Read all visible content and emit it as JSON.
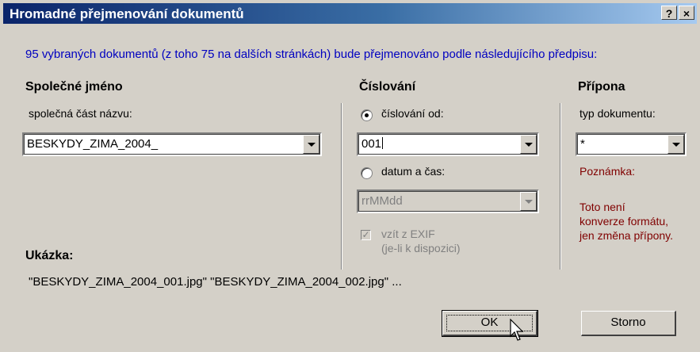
{
  "window": {
    "title": "Hromadné přejmenování dokumentů",
    "help_label": "?",
    "close_label": "×"
  },
  "info_text": "95 vybraných dokumentů (z toho 75 na dalších stránkách) bude přejmenováno podle následujícího předpisu:",
  "common_name": {
    "title": "Společné jméno",
    "field_label": "společná část názvu:",
    "value": "BESKYDY_ZIMA_2004_"
  },
  "numbering": {
    "title": "Číslování",
    "option_number_label": "číslování od:",
    "option_number_selected": true,
    "number_value": "001",
    "option_datetime_label": "datum a čas:",
    "datetime_format": "rrMMdd",
    "exif_label_line1": "vzít z EXIF",
    "exif_label_line2": "(je-li k dispozici)",
    "exif_checked": true
  },
  "extension": {
    "title": "Přípona",
    "field_label": "typ dokumentu:",
    "value": "*",
    "note_title": "Poznámka:",
    "note_line1": "Toto není",
    "note_line2": "konverze formátu,",
    "note_line3": "jen změna přípony."
  },
  "preview": {
    "title": "Ukázka:",
    "text": "\"BESKYDY_ZIMA_2004_001.jpg\"  \"BESKYDY_ZIMA_2004_002.jpg\" ..."
  },
  "buttons": {
    "ok_label": "OK",
    "cancel_label": "Storno"
  },
  "colors": {
    "title_bar_start": "#0a246a",
    "title_bar_end": "#a6caf0",
    "info_text": "#0000c0",
    "note_text": "#800000",
    "dialog_background": "#d4d0c8"
  }
}
